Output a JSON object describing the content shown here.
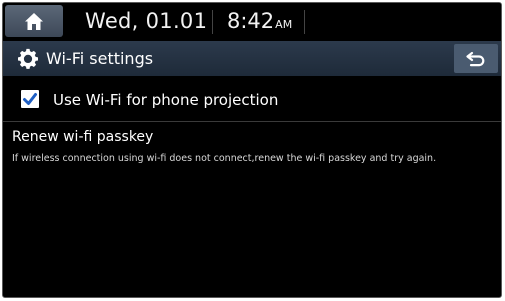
{
  "status_bar": {
    "home_icon": "home-icon",
    "date": "Wed, 01.01",
    "time": "8:42",
    "ampm": "AM"
  },
  "header": {
    "settings_icon": "gear-icon",
    "title": "Wi-Fi settings",
    "back_icon": "back-arrow-icon"
  },
  "options": {
    "phone_projection": {
      "label": "Use Wi-Fi for phone projection",
      "checked": true
    },
    "renew_passkey": {
      "title": "Renew wi-fi passkey",
      "description": "If wireless connection using wi-fi does not connect,renew the wi-fi passkey and try again."
    }
  },
  "colors": {
    "screen_bg": "#000000",
    "title_bar": "#26344a",
    "home_button": "#4a5667",
    "checkbox_accent": "#1f5fc4"
  }
}
